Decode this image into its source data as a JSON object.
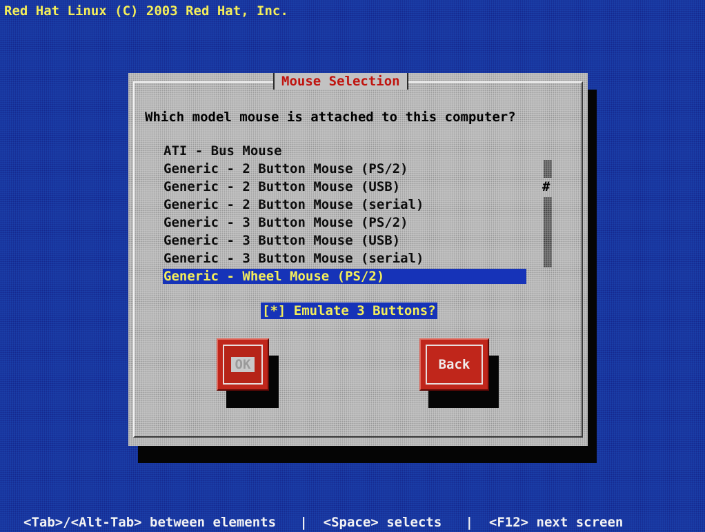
{
  "header": {
    "copyright": "Red Hat Linux (C) 2003 Red Hat, Inc."
  },
  "dialog": {
    "title": "Mouse Selection",
    "question": "Which model mouse is attached to this computer?",
    "mouse_list": {
      "items": [
        "ATI - Bus Mouse",
        "Generic - 2 Button Mouse (PS/2)",
        "Generic - 2 Button Mouse (USB)",
        "Generic - 2 Button Mouse (serial)",
        "Generic - 3 Button Mouse (PS/2)",
        "Generic - 3 Button Mouse (USB)",
        "Generic - 3 Button Mouse (serial)",
        "Generic - Wheel Mouse (PS/2)"
      ],
      "selected_index": 7,
      "scroll_indicator": "#"
    },
    "emulate_checkbox": {
      "label": "[*] Emulate 3 Buttons?",
      "checked": true
    },
    "buttons": {
      "ok_label": "OK",
      "back_label": "Back"
    }
  },
  "footer": {
    "help": "<Tab>/<Alt-Tab> between elements   |  <Space> selects   |  <F12> next screen"
  },
  "colors": {
    "background": "#1a3ea8",
    "dialog": "#c2c2c2",
    "title_text": "#c0140f",
    "highlight": "#1633b8",
    "highlight_text": "#f4ee5a",
    "button": "#c0261b"
  }
}
